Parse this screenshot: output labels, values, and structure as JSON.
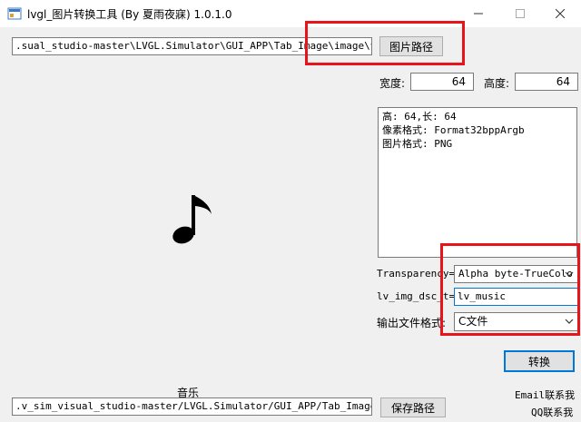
{
  "window": {
    "title": "lvgl_图片转换工具 (By 夏雨夜寐) 1.0.1.0"
  },
  "image_path": {
    "value": ".sual_studio-master\\LVGL.Simulator\\GUI_APP\\Tab_Image\\image\\音乐.png",
    "button_label": "图片路径"
  },
  "size": {
    "width_label": "宽度:",
    "width_value": "64",
    "height_label": "高度:",
    "height_value": "64"
  },
  "info": {
    "lines": [
      "高: 64,长: 64",
      "像素格式: Format32bppArgb",
      "图片格式: PNG"
    ]
  },
  "options": {
    "transparency_label": "Transparency=",
    "transparency_value": "Alpha byte-TrueColo",
    "dsc_label": "lv_img_dsc_t=",
    "dsc_value": "lv_music",
    "format_label": "输出文件格式:",
    "format_value": "C文件"
  },
  "convert_button": "转换",
  "file_name": "音乐",
  "save_path": {
    "value": ".v_sim_visual_studio-master/LVGL.Simulator/GUI_APP/Tab_Image/image/",
    "button_label": "保存路径"
  },
  "contact": {
    "email": "Email联系我",
    "qq": "QQ联系我"
  },
  "colors": {
    "highlight": "#e8141b",
    "default_button_border": "#0078d7"
  }
}
